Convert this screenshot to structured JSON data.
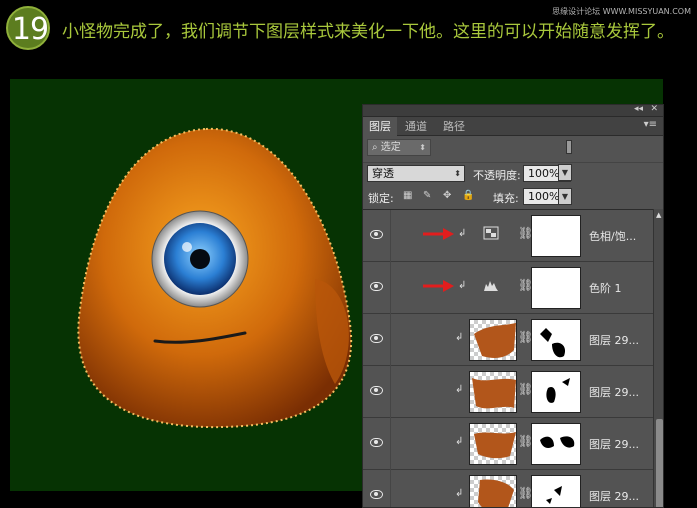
{
  "header": {
    "step_number": "19",
    "instruction": "小怪物完成了，我们调节下图层样式来美化一下他。这里的可以开始随意发挥了。",
    "watermark": "思缘设计论坛 WWW.MISSYUAN.COM"
  },
  "colors": {
    "canvas_bg": "#063303",
    "panel_bg": "#535353",
    "accent_text": "#a9c83c",
    "arrow": "#e21d1d"
  },
  "panel": {
    "tabs": [
      {
        "label": "图层",
        "active": true
      },
      {
        "label": "通道",
        "active": false
      },
      {
        "label": "路径",
        "active": false
      }
    ],
    "filter": {
      "label": "选定",
      "icon": "search-icon"
    },
    "blend_mode": "穿透",
    "opacity_label": "不透明度:",
    "opacity_value": "100%",
    "lock_label": "锁定:",
    "fill_label": "填充:",
    "fill_value": "100%",
    "layers": [
      {
        "name": "色相/饱...",
        "type": "adjustment",
        "icon": "hue-saturation-icon",
        "marked": true
      },
      {
        "name": "色阶 1",
        "type": "adjustment",
        "icon": "levels-icon",
        "marked": true
      },
      {
        "name": "图层 29...",
        "type": "pixel",
        "marked": false
      },
      {
        "name": "图层 29...",
        "type": "pixel",
        "marked": false
      },
      {
        "name": "图层 29...",
        "type": "pixel",
        "marked": false
      },
      {
        "name": "图层 29...",
        "type": "pixel",
        "marked": false
      }
    ]
  }
}
